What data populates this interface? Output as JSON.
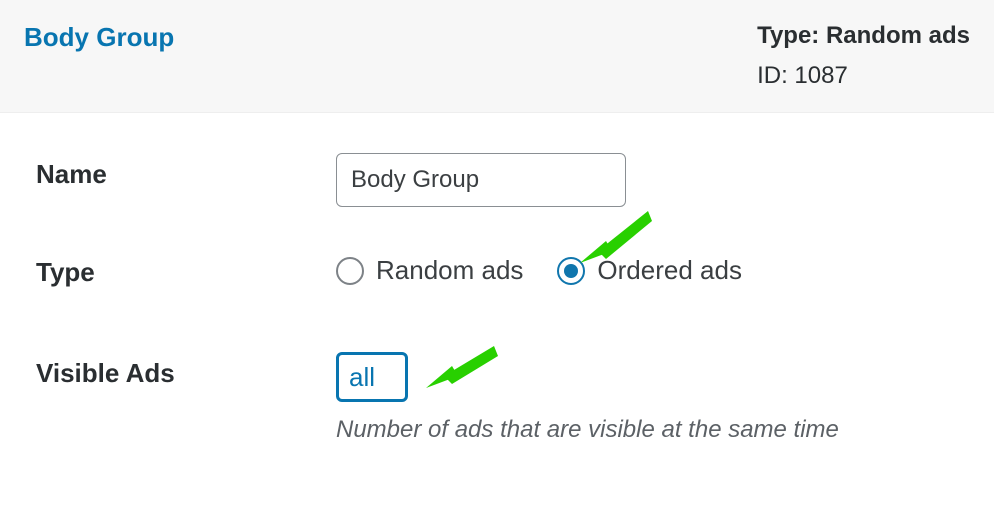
{
  "header": {
    "title": "Body Group",
    "type_label": "Type:",
    "type_value": "Random ads",
    "id_label": "ID:",
    "id_value": "1087"
  },
  "form": {
    "name": {
      "label": "Name",
      "value": "Body Group"
    },
    "type": {
      "label": "Type",
      "options": {
        "random": "Random ads",
        "ordered": "Ordered ads"
      }
    },
    "visible_ads": {
      "label": "Visible Ads",
      "value": "all",
      "help": "Number of ads that are visible at the same time"
    }
  }
}
